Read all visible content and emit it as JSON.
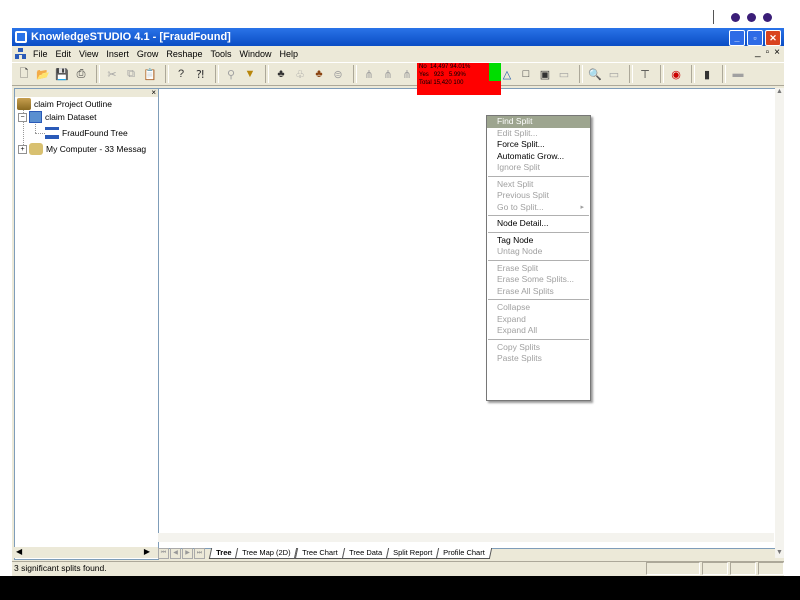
{
  "window": {
    "title": "KnowledgeSTUDIO 4.1 - [FraudFound]",
    "buttons": {
      "minimize": "_",
      "restore": "▫",
      "close": "✕"
    }
  },
  "menu": {
    "items": [
      "File",
      "Edit",
      "View",
      "Insert",
      "Grow",
      "Reshape",
      "Tools",
      "Window",
      "Help"
    ],
    "mdi_buttons": [
      "_",
      "▫",
      "×"
    ]
  },
  "toolbar": {
    "icons": [
      "new-icon",
      "open-icon",
      "save-icon",
      "print-icon",
      "cut-icon",
      "copy-icon",
      "paste-icon",
      "help-icon",
      "context-help-icon",
      "split-icon",
      "filter-icon",
      "grow-icon",
      "prune-icon",
      "expand-icon",
      "table-icon",
      "split-tool-1-icon",
      "split-tool-2-icon",
      "split-tool-3-icon",
      "tree-icon",
      "tag-icon",
      "chart-icon",
      "triangle-icon",
      "box-icon",
      "box2-icon",
      "rule-icon",
      "find-icon",
      "rule2-icon",
      "crane-icon",
      "target-icon",
      "book-icon",
      "marker-icon"
    ]
  },
  "left_pane": {
    "close": "×",
    "tree": [
      {
        "label": "claim Project Outline"
      },
      {
        "label": "claim Dataset",
        "expander": "−"
      },
      {
        "label": "FraudFound Tree"
      },
      {
        "label": "My Computer - 33 Messag",
        "expander": "+"
      }
    ]
  },
  "node": {
    "rows": [
      {
        "label": "No",
        "count": "14,497",
        "pct": "94.01%"
      },
      {
        "label": "Yes",
        "count": "923",
        "pct": "5.99%"
      },
      {
        "label": "Total",
        "count": "15,420",
        "pct": "100"
      }
    ]
  },
  "context_menu": {
    "items": [
      {
        "label": "Find Split",
        "state": "highlighted"
      },
      {
        "label": "Edit Split...",
        "state": "disabled"
      },
      {
        "label": "Force Split...",
        "state": "enabled"
      },
      {
        "label": "Automatic Grow...",
        "state": "enabled"
      },
      {
        "label": "Ignore Split",
        "state": "disabled"
      },
      {
        "separator": true
      },
      {
        "label": "Next Split",
        "state": "disabled"
      },
      {
        "label": "Previous Split",
        "state": "disabled"
      },
      {
        "label": "Go to Split...",
        "state": "disabled",
        "submenu": true
      },
      {
        "separator": true
      },
      {
        "label": "Node Detail...",
        "state": "enabled"
      },
      {
        "separator": true
      },
      {
        "label": "Tag Node",
        "state": "enabled"
      },
      {
        "label": "Untag Node",
        "state": "disabled"
      },
      {
        "separator": true
      },
      {
        "label": "Erase Split",
        "state": "disabled"
      },
      {
        "label": "Erase Some Splits...",
        "state": "disabled"
      },
      {
        "label": "Erase All Splits",
        "state": "disabled"
      },
      {
        "separator": true
      },
      {
        "label": "Collapse",
        "state": "disabled"
      },
      {
        "label": "Expand",
        "state": "disabled"
      },
      {
        "label": "Expand All",
        "state": "disabled"
      },
      {
        "separator": true
      },
      {
        "label": "Copy Splits",
        "state": "disabled"
      },
      {
        "label": "Paste Splits",
        "state": "disabled"
      }
    ],
    "highlight_color": "#9da58f"
  },
  "tabs": {
    "items": [
      "Tree",
      "Tree Map (2D)",
      "Tree Chart",
      "Tree Data",
      "Split Report",
      "Profile Chart"
    ],
    "active": "Tree"
  },
  "status": {
    "text": "3 significant splits found."
  },
  "colors": {
    "node_red": "#ff0000",
    "node_green": "#00dd00",
    "title_blue": "#0a4dc4",
    "window_bg": "#ece9d8",
    "slide_dots": "#3b1e78"
  }
}
